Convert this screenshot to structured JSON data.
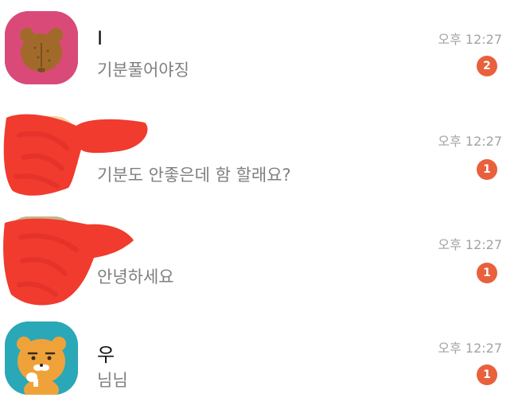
{
  "colors": {
    "badge": "#e8603c",
    "time_text": "#a3a3a3",
    "message_text": "#7f7f7f",
    "redaction": "#f03b2e"
  },
  "chats": [
    {
      "name": "I",
      "message": "기분풀어야징",
      "time": "오후 12:27",
      "unread": "2",
      "avatar_icon": "bear-back-icon",
      "avatar_bg": "#d94a78"
    },
    {
      "name": "",
      "message": "기분도 안좋은데 함 할래요?",
      "time": "오후 12:27",
      "unread": "1",
      "avatar_icon": "redacted-avatar",
      "avatar_bg": "#f2d3a0"
    },
    {
      "name": "",
      "message": "안녕하세요",
      "time": "오후 12:27",
      "unread": "1",
      "avatar_icon": "redacted-avatar",
      "avatar_bg": "#c9b38a"
    },
    {
      "name": "우",
      "message": "님님",
      "time": "오후 12:27",
      "unread": "1",
      "avatar_icon": "lion-character-icon",
      "avatar_bg": "#2aa8b8"
    }
  ]
}
